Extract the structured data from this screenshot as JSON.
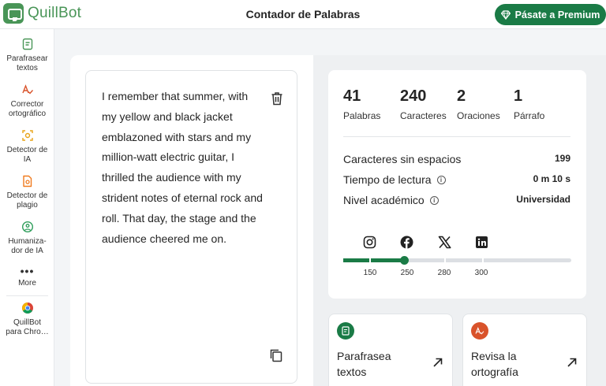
{
  "app": {
    "logo_text": "QuillBot",
    "page_title": "Contador de Palabras",
    "premium_button": "Pásate a Premium"
  },
  "sidebar": {
    "items": [
      {
        "label_1": "Parafrasear",
        "label_2": "textos",
        "icon": "paraphrase-icon"
      },
      {
        "label_1": "Corrector",
        "label_2": "ortográfico",
        "icon": "grammar-icon"
      },
      {
        "label_1": "Detector de",
        "label_2": "IA",
        "icon": "ai-detector-icon"
      },
      {
        "label_1": "Detector de",
        "label_2": "plagio",
        "icon": "plagiarism-icon"
      },
      {
        "label_1": "Humaniza-",
        "label_2": "dor de IA",
        "icon": "humanizer-icon"
      }
    ],
    "more_label": "More",
    "chrome": {
      "label_1": "QuillBot",
      "label_2": "para Chro…",
      "icon": "chrome-icon"
    }
  },
  "editor": {
    "lines": [
      "I remember that summer, with",
      "my yellow and black jacket",
      "emblazoned with stars and my",
      "million-watt electric guitar, I",
      "thrilled the audience with my",
      "strident notes of eternal rock and",
      "roll.  That day, the stage and the",
      "audience cheered me on."
    ]
  },
  "stats": {
    "words": {
      "value": "41",
      "label": "Palabras"
    },
    "characters": {
      "value": "240",
      "label": "Caracteres"
    },
    "sentences": {
      "value": "2",
      "label": "Oraciones"
    },
    "paragraphs": {
      "value": "1",
      "label": "Párrafo"
    },
    "chars_no_spaces": {
      "label": "Caracteres sin espacios",
      "value": "199"
    },
    "reading_time": {
      "label": "Tiempo de lectura",
      "value": "0 m 10 s"
    },
    "academic_level": {
      "label": "Nivel académico",
      "value": "Universidad"
    }
  },
  "social_limits": {
    "ticks": [
      "150",
      "250",
      "280",
      "300"
    ],
    "current_characters": 240,
    "icons": [
      "instagram-icon",
      "facebook-icon",
      "x-icon",
      "linkedin-icon"
    ]
  },
  "tools": [
    {
      "label_1": "Parafrasea",
      "label_2": "textos",
      "color": "#1a7b46"
    },
    {
      "label_1": "Revisa la",
      "label_2": "ortografía",
      "color": "#d9532b"
    }
  ],
  "colors": {
    "brand_green": "#499557",
    "accent_green": "#1a7b46",
    "grammar_orange": "#d9532b"
  }
}
